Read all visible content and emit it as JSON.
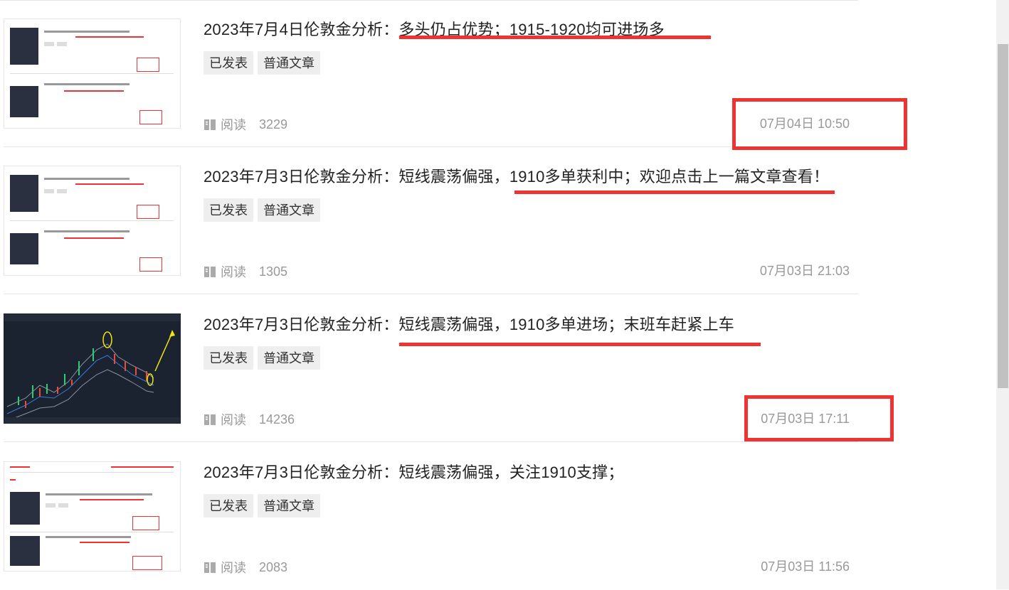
{
  "items": [
    {
      "title": "2023年7月4日伦敦金分析：多头仍占优势；1915-1920均可进场多",
      "tags": [
        "已发表",
        "普通文章"
      ],
      "read_label": "阅读",
      "reads": "3229",
      "date": "07月04日 10:50"
    },
    {
      "title": "2023年7月3日伦敦金分析：短线震荡偏强，1910多单获利中；欢迎点击上一篇文章查看！",
      "tags": [
        "已发表",
        "普通文章"
      ],
      "read_label": "阅读",
      "reads": "1305",
      "date": "07月03日 21:03"
    },
    {
      "title": "2023年7月3日伦敦金分析：短线震荡偏强，1910多单进场；末班车赶紧上车",
      "tags": [
        "已发表",
        "普通文章"
      ],
      "read_label": "阅读",
      "reads": "14236",
      "date": "07月03日 17:11"
    },
    {
      "title": "2023年7月3日伦敦金分析：短线震荡偏强，关注1910支撑；",
      "tags": [
        "已发表",
        "普通文章"
      ],
      "read_label": "阅读",
      "reads": "2083",
      "date": "07月03日 11:56"
    }
  ],
  "colors": {
    "annotation_red": "#ee3333",
    "divider": "#e6e6e6",
    "meta_gray": "#999999"
  }
}
